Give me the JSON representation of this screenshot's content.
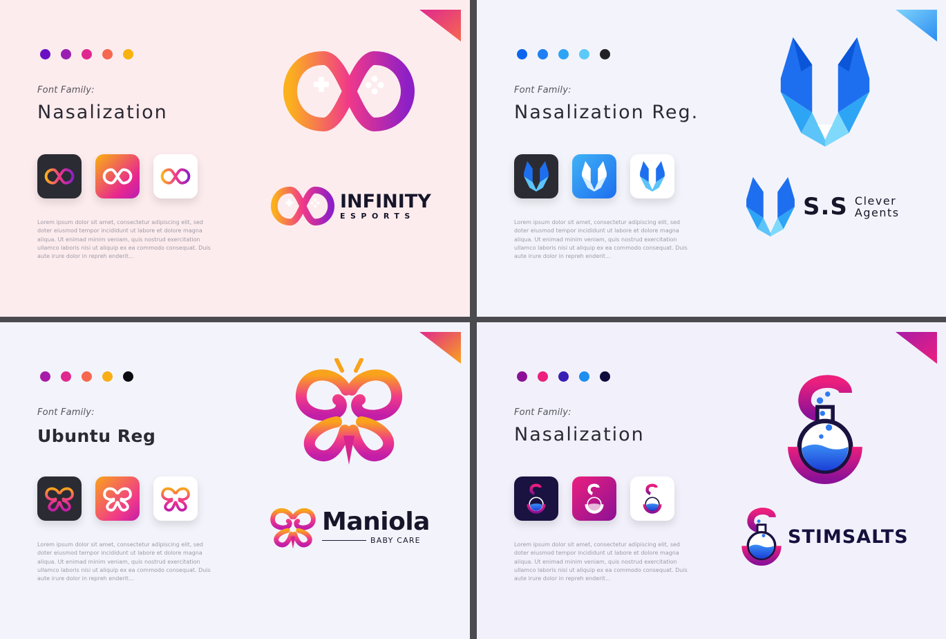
{
  "panels": [
    {
      "bg": "#fdecee",
      "dots": [
        "#6a0fc4",
        "#9a1fb0",
        "#e0298f",
        "#f5684f",
        "#f9b20f"
      ],
      "font_label": "Font Family:",
      "font_name": "Nasalization",
      "tile_bgs": [
        "#2b2b33",
        "gradient-orange-pink",
        "#ffffff"
      ],
      "lorem": "Lorem ipsum dolor sit amet, consectetur adipiscing elit, sed doter eiusmod tempor incididunt ut labore et dolore magna aliqua. Ut enimad minim veniam, quis nostrud exercitation ullamco laboris nisi ut aliquip ex ea commodo consequat. Duis aute irure dolor in repreh enderit...",
      "brand": {
        "title": "INFINITY",
        "sub": "ESPORTS"
      },
      "icon": "infinity-gamepad-icon",
      "accent": [
        "#fbb01d",
        "#f0398a",
        "#8d1fc6"
      ]
    },
    {
      "bg": "#f3f4fb",
      "dots": [
        "#0d65ee",
        "#1e80f2",
        "#2ea4f5",
        "#5ccaf9",
        "#222226"
      ],
      "font_label": "Font Family:",
      "font_name": "Nasalization Reg.",
      "tile_bgs": [
        "#2b2b33",
        "gradient-blue",
        "#ffffff"
      ],
      "lorem": "Lorem ipsum dolor sit amet, consectetur adipiscing elit, sed doter eiusmod tempor incididunt ut labore et dolore magna aliqua. Ut enimad minim veniam, quis nostrud exercitation ullamco laboris nisi ut aliquip ex ea commodo consequat. Duis aute irure dolor in repreh enderit...",
      "brand": {
        "title": "S.S",
        "sub_line1": "Clever",
        "sub_line2": "Agents"
      },
      "icon": "fox-head-icon",
      "accent": [
        "#0d65ee",
        "#2ea4f5",
        "#7fd9fb"
      ]
    },
    {
      "bg": "#f3f4fb",
      "dots": [
        "#a81ba9",
        "#e0298f",
        "#f5684f",
        "#f9ae16",
        "#0b0b10"
      ],
      "font_label": "Font Family:",
      "font_name": "Ubuntu Reg",
      "tile_bgs": [
        "#2b2b33",
        "gradient-orange-pink",
        "#ffffff"
      ],
      "lorem": "Lorem ipsum dolor sit amet, consectetur adipiscing elit, sed doter eiusmod tempor incididunt ut labore et dolore magna aliqua. Ut enimad minim veniam, quis nostrud exercitation ullamco laboris nisi ut aliquip ex ea commodo consequat. Duis aute irure dolor in repreh enderit...",
      "brand": {
        "title": "Maniola",
        "sub": "BABY CARE"
      },
      "icon": "butterfly-icon",
      "accent": [
        "#f9a31c",
        "#f0398a",
        "#c21ea8"
      ]
    },
    {
      "bg": "#f2f1fb",
      "dots": [
        "#8b1196",
        "#ec1f7d",
        "#3a1fb5",
        "#1e8ef0",
        "#100c3e"
      ],
      "font_label": "Font Family:",
      "font_name": "Nasalization",
      "tile_bgs": [
        "#1a1240",
        "gradient-purple-pink",
        "#ffffff"
      ],
      "lorem": "Lorem ipsum dolor sit amet, consectetur adipiscing elit, sed doter eiusmod tempor incididunt ut labore et dolore magna aliqua. Ut enimad minim veniam, quis nostrud exercitation ullamco laboris nisi ut aliquip ex ea commodo consequat. Duis aute irure dolor in repreh enderit...",
      "brand": {
        "title": "STIMSALTS"
      },
      "icon": "flask-s-icon",
      "accent": [
        "#ec1f7d",
        "#8b1196",
        "#1e5df0"
      ]
    }
  ]
}
